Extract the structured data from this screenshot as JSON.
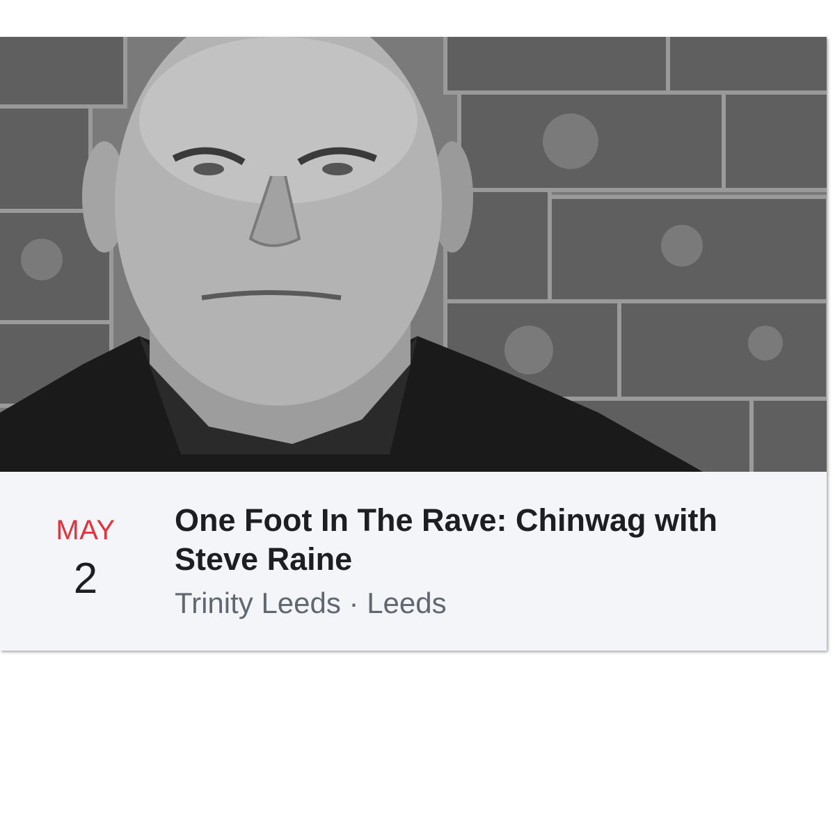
{
  "event": {
    "month": "MAY",
    "day": "2",
    "title": "One Foot In The Rave: Chinwag with Steve Raine",
    "location": "Trinity Leeds · Leeds",
    "accent_color": "#e4323c"
  }
}
